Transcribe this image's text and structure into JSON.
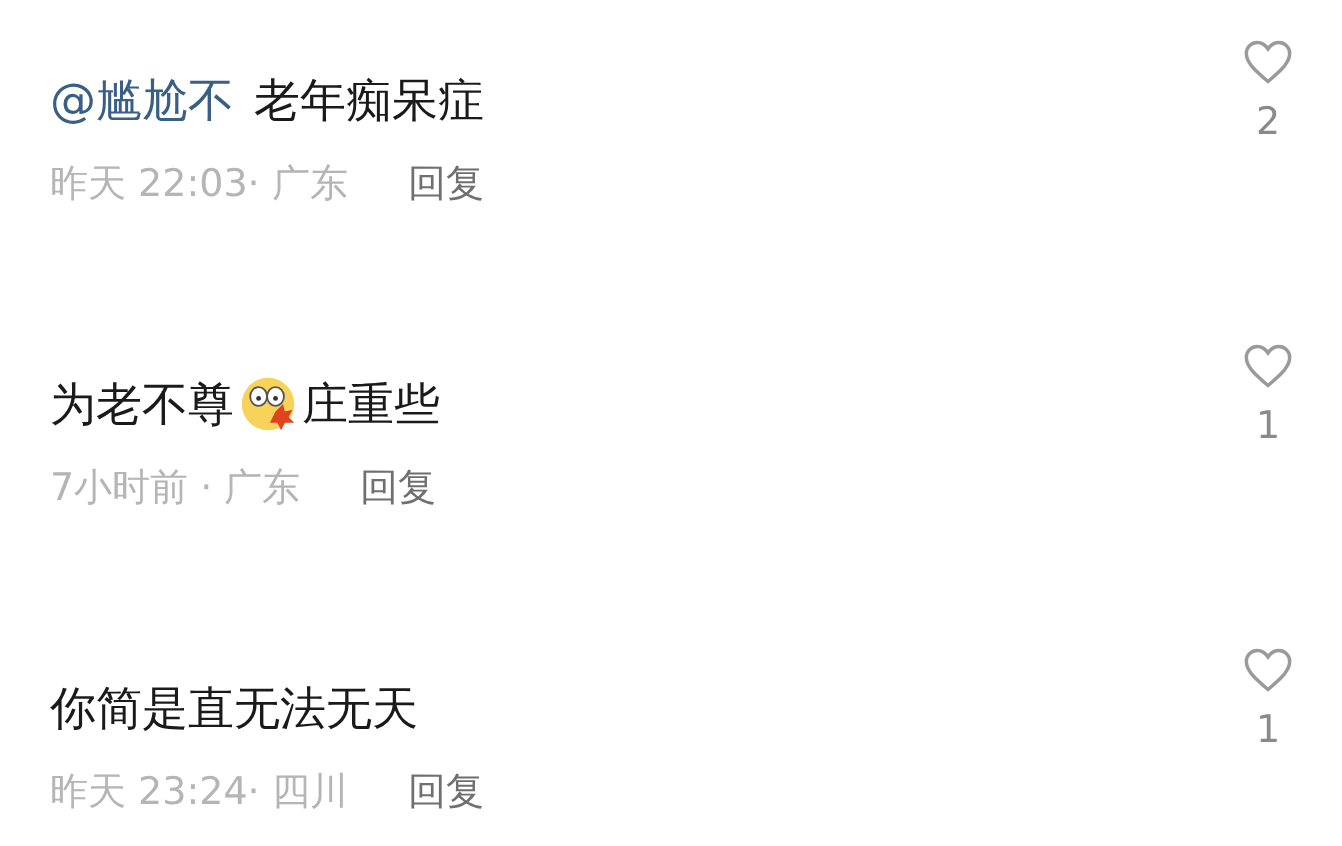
{
  "comments": [
    {
      "parts": [
        {
          "kind": "mention",
          "text": "@尴尬不"
        },
        {
          "kind": "text",
          "text": "老年痴呆症"
        }
      ],
      "time_location": "昨天 22:03· 广东",
      "reply": "回复",
      "likes": "2",
      "liked": false
    },
    {
      "parts": [
        {
          "kind": "text",
          "text": "为老不尊"
        },
        {
          "kind": "emoji"
        },
        {
          "kind": "text",
          "text": "庄重些"
        }
      ],
      "time_location": "7小时前 · 广东",
      "reply": "回复",
      "likes": "1",
      "liked": false
    },
    {
      "parts": [
        {
          "kind": "text",
          "text": "你简是直无法无天"
        }
      ],
      "time_location": "昨天 23:24· 四川",
      "reply": "回复",
      "likes": "1",
      "liked": false
    }
  ]
}
